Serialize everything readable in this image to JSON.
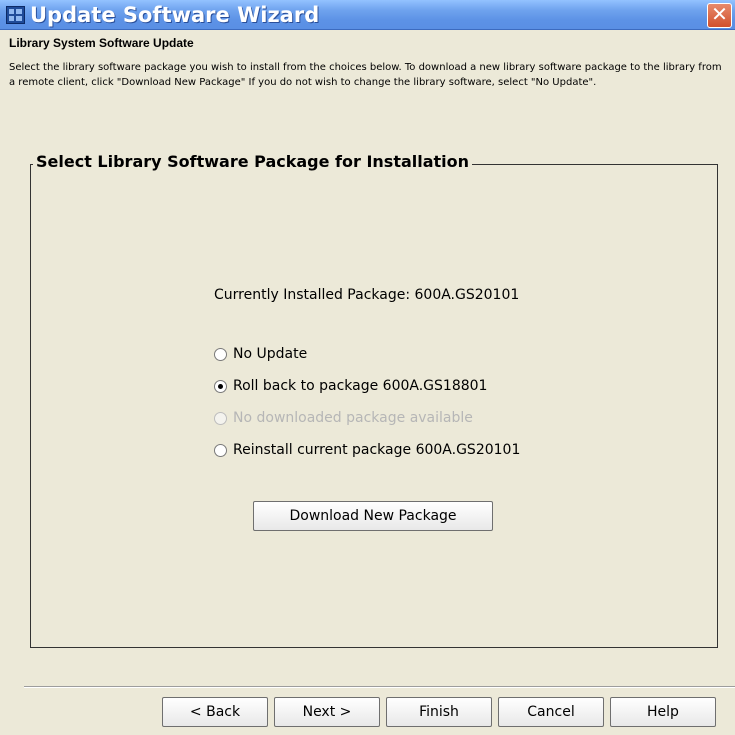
{
  "window": {
    "title": "Update Software Wizard",
    "close_glyph": "✕",
    "app_icon": "app-window-icon"
  },
  "page": {
    "heading": "Library System Software Update",
    "description": "Select the library software package you wish to install from the choices below. To download a new library software package to the library from a remote client, click \"Download New Package\" If you do not wish to change the library software, select \"No Update\"."
  },
  "group": {
    "title": "Select Library Software Package for Installation",
    "installed_label": "Currently Installed Package: 600A.GS20101",
    "options": [
      {
        "label": "No Update",
        "selected": false,
        "enabled": true
      },
      {
        "label": "Roll back to package 600A.GS18801",
        "selected": true,
        "enabled": true
      },
      {
        "label": "No downloaded package available",
        "selected": false,
        "enabled": false
      },
      {
        "label": "Reinstall current package 600A.GS20101",
        "selected": false,
        "enabled": true
      }
    ],
    "download_button": "Download New Package"
  },
  "footer": {
    "back": "< Back",
    "next": "Next >",
    "finish": "Finish",
    "cancel": "Cancel",
    "help": "Help"
  },
  "colors": {
    "title_bar": "#5C92E6",
    "close_button": "#D1502D",
    "background": "#ECE9D8",
    "disabled_text": "#B6B6B6"
  }
}
